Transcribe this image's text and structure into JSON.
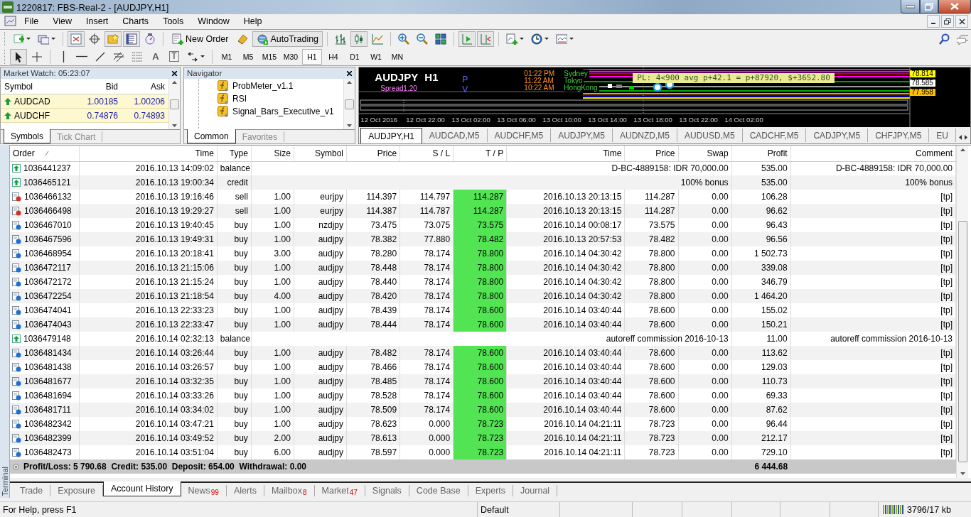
{
  "window": {
    "title": "1220817: FBS-Real-2 - [AUDJPY,H1]"
  },
  "menu": [
    "File",
    "View",
    "Insert",
    "Charts",
    "Tools",
    "Window",
    "Help"
  ],
  "toolbar": {
    "new_order": "New Order",
    "auto_trading": "AutoTrading"
  },
  "drawing_toolbar": {
    "text_tool": "A",
    "text_label_tool": "T"
  },
  "timeframes": [
    {
      "label": "M1",
      "selected": false
    },
    {
      "label": "M5",
      "selected": false
    },
    {
      "label": "M15",
      "selected": false
    },
    {
      "label": "M30",
      "selected": false
    },
    {
      "label": "H1",
      "selected": true
    },
    {
      "label": "H4",
      "selected": false
    },
    {
      "label": "D1",
      "selected": false
    },
    {
      "label": "W1",
      "selected": false
    },
    {
      "label": "MN",
      "selected": false
    }
  ],
  "market_watch": {
    "title": "Market Watch: 05:23:07",
    "columns": [
      "Symbol",
      "Bid",
      "Ask"
    ],
    "rows": [
      {
        "symbol": "AUDCAD",
        "bid": "1.00185",
        "ask": "1.00206"
      },
      {
        "symbol": "AUDCHF",
        "bid": "0.74876",
        "ask": "0.74893"
      }
    ],
    "tabs": [
      {
        "label": "Symbols",
        "selected": true
      },
      {
        "label": "Tick Chart",
        "selected": false
      }
    ]
  },
  "navigator": {
    "title": "Navigator",
    "items": [
      "ProbMeter_v1.1",
      "RSI",
      "Signal_Bars_Executive_v1"
    ],
    "tabs": [
      {
        "label": "Common",
        "selected": true
      },
      {
        "label": "Favorites",
        "selected": false
      }
    ]
  },
  "chart": {
    "symbol": "AUDJPY",
    "timeframe": "H1",
    "spread_label": "Spread",
    "spread": "1.20",
    "markers": [
      "P",
      "V"
    ],
    "sessions": [
      {
        "time": "01:22 PM",
        "city": "Sydney"
      },
      {
        "time": "11:22 AM",
        "city": "Tokyo"
      },
      {
        "time": "10:22 AM",
        "city": "HongKong"
      }
    ],
    "pl_text": "PL: 4<900 avg p+42.1 = p+87920, $+3652.80",
    "prices": [
      {
        "value": "78.814",
        "color": "#ffff00"
      },
      {
        "value": "78.585",
        "color": "#ffffff"
      },
      {
        "value": "77.958",
        "color": "#ffc000"
      }
    ],
    "time_labels": [
      "12 Oct 2016",
      "12 Oct 22:00",
      "13 Oct 02:00",
      "13 Oct 06:00",
      "13 Oct 10:00",
      "13 Oct 14:00",
      "13 Oct 18:00",
      "13 Oct 22:00",
      "14 Oct 02:00"
    ]
  },
  "chart_tabs": [
    {
      "label": "AUDJPY,H1",
      "selected": true
    },
    {
      "label": "AUDCAD,M5",
      "selected": false
    },
    {
      "label": "AUDCHF,M5",
      "selected": false
    },
    {
      "label": "AUDJPY,M5",
      "selected": false
    },
    {
      "label": "AUDNZD,M5",
      "selected": false
    },
    {
      "label": "AUDUSD,M5",
      "selected": false
    },
    {
      "label": "CADCHF,M5",
      "selected": false
    },
    {
      "label": "CADJPY,M5",
      "selected": false
    },
    {
      "label": "CHFJPY,M5",
      "selected": false
    },
    {
      "label": "EU",
      "selected": false
    }
  ],
  "history": {
    "columns": [
      "Order",
      "Time",
      "Type",
      "Size",
      "Symbol",
      "Price",
      "S / L",
      "T / P",
      "Time",
      "Price",
      "Swap",
      "Profit",
      "Comment"
    ],
    "rows": [
      {
        "kind": "balance",
        "order": "1036441237",
        "open_time": "2016.10.13 14:09:02",
        "type": "balance",
        "description": "D-BC-4889158: IDR 70,000.00",
        "profit": "535.00",
        "comment": "D-BC-4889158: IDR 70,000.00"
      },
      {
        "kind": "balance",
        "order": "1036465121",
        "open_time": "2016.10.13 19:00:34",
        "type": "credit",
        "description": "100% bonus",
        "profit": "535.00",
        "comment": "100% bonus"
      },
      {
        "kind": "sell",
        "order": "1036466132",
        "open_time": "2016.10.13 19:16:46",
        "type": "sell",
        "size": "1.00",
        "symbol": "eurjpy",
        "price": "114.397",
        "sl": "114.797",
        "tp": "114.287",
        "close_time": "2016.10.13 20:13:15",
        "close_price": "114.287",
        "swap": "0.00",
        "profit": "106.28",
        "comment": "[tp]"
      },
      {
        "kind": "sell",
        "order": "1036466498",
        "open_time": "2016.10.13 19:29:27",
        "type": "sell",
        "size": "1.00",
        "symbol": "eurjpy",
        "price": "114.387",
        "sl": "114.787",
        "tp": "114.287",
        "close_time": "2016.10.13 20:13:15",
        "close_price": "114.287",
        "swap": "0.00",
        "profit": "96.62",
        "comment": "[tp]"
      },
      {
        "kind": "buy",
        "order": "1036467010",
        "open_time": "2016.10.13 19:40:45",
        "type": "buy",
        "size": "1.00",
        "symbol": "nzdjpy",
        "price": "73.475",
        "sl": "73.075",
        "tp": "73.575",
        "close_time": "2016.10.14 00:08:17",
        "close_price": "73.575",
        "swap": "0.00",
        "profit": "96.43",
        "comment": "[tp]"
      },
      {
        "kind": "buy",
        "order": "1036467596",
        "open_time": "2016.10.13 19:49:31",
        "type": "buy",
        "size": "1.00",
        "symbol": "audjpy",
        "price": "78.382",
        "sl": "77.880",
        "tp": "78.482",
        "close_time": "2016.10.13 20:57:53",
        "close_price": "78.482",
        "swap": "0.00",
        "profit": "96.56",
        "comment": "[tp]"
      },
      {
        "kind": "buy",
        "order": "1036468954",
        "open_time": "2016.10.13 20:18:41",
        "type": "buy",
        "size": "3.00",
        "symbol": "audjpy",
        "price": "78.280",
        "sl": "78.174",
        "tp": "78.800",
        "close_time": "2016.10.14 04:30:42",
        "close_price": "78.800",
        "swap": "0.00",
        "profit": "1 502.73",
        "comment": "[tp]"
      },
      {
        "kind": "buy",
        "order": "1036472117",
        "open_time": "2016.10.13 21:15:06",
        "type": "buy",
        "size": "1.00",
        "symbol": "audjpy",
        "price": "78.448",
        "sl": "78.174",
        "tp": "78.800",
        "close_time": "2016.10.14 04:30:42",
        "close_price": "78.800",
        "swap": "0.00",
        "profit": "339.08",
        "comment": "[tp]"
      },
      {
        "kind": "buy",
        "order": "1036472172",
        "open_time": "2016.10.13 21:15:24",
        "type": "buy",
        "size": "1.00",
        "symbol": "audjpy",
        "price": "78.440",
        "sl": "78.174",
        "tp": "78.800",
        "close_time": "2016.10.14 04:30:42",
        "close_price": "78.800",
        "swap": "0.00",
        "profit": "346.79",
        "comment": "[tp]"
      },
      {
        "kind": "buy",
        "order": "1036472254",
        "open_time": "2016.10.13 21:18:54",
        "type": "buy",
        "size": "4.00",
        "symbol": "audjpy",
        "price": "78.420",
        "sl": "78.174",
        "tp": "78.800",
        "close_time": "2016.10.14 04:30:42",
        "close_price": "78.800",
        "swap": "0.00",
        "profit": "1 464.20",
        "comment": "[tp]"
      },
      {
        "kind": "buy",
        "order": "1036474041",
        "open_time": "2016.10.13 22:33:23",
        "type": "buy",
        "size": "1.00",
        "symbol": "audjpy",
        "price": "78.439",
        "sl": "78.174",
        "tp": "78.600",
        "close_time": "2016.10.14 03:40:44",
        "close_price": "78.600",
        "swap": "0.00",
        "profit": "155.02",
        "comment": "[tp]"
      },
      {
        "kind": "buy",
        "order": "1036474043",
        "open_time": "2016.10.13 22:33:47",
        "type": "buy",
        "size": "1.00",
        "symbol": "audjpy",
        "price": "78.444",
        "sl": "78.174",
        "tp": "78.600",
        "close_time": "2016.10.14 03:40:44",
        "close_price": "78.600",
        "swap": "0.00",
        "profit": "150.21",
        "comment": "[tp]"
      },
      {
        "kind": "balance",
        "order": "1036479148",
        "open_time": "2016.10.14 02:32:13",
        "type": "balance",
        "description": "autoreff commission 2016-10-13",
        "profit": "11.00",
        "comment": "autoreff commission 2016-10-13"
      },
      {
        "kind": "buy",
        "order": "1036481434",
        "open_time": "2016.10.14 03:26:44",
        "type": "buy",
        "size": "1.00",
        "symbol": "audjpy",
        "price": "78.482",
        "sl": "78.174",
        "tp": "78.600",
        "close_time": "2016.10.14 03:40:44",
        "close_price": "78.600",
        "swap": "0.00",
        "profit": "113.62",
        "comment": "[tp]"
      },
      {
        "kind": "buy",
        "order": "1036481438",
        "open_time": "2016.10.14 03:26:57",
        "type": "buy",
        "size": "1.00",
        "symbol": "audjpy",
        "price": "78.466",
        "sl": "78.174",
        "tp": "78.600",
        "close_time": "2016.10.14 03:40:44",
        "close_price": "78.600",
        "swap": "0.00",
        "profit": "129.03",
        "comment": "[tp]"
      },
      {
        "kind": "buy",
        "order": "1036481677",
        "open_time": "2016.10.14 03:32:35",
        "type": "buy",
        "size": "1.00",
        "symbol": "audjpy",
        "price": "78.485",
        "sl": "78.174",
        "tp": "78.600",
        "close_time": "2016.10.14 03:40:44",
        "close_price": "78.600",
        "swap": "0.00",
        "profit": "110.73",
        "comment": "[tp]"
      },
      {
        "kind": "buy",
        "order": "1036481694",
        "open_time": "2016.10.14 03:33:26",
        "type": "buy",
        "size": "1.00",
        "symbol": "audjpy",
        "price": "78.528",
        "sl": "78.174",
        "tp": "78.600",
        "close_time": "2016.10.14 03:40:44",
        "close_price": "78.600",
        "swap": "0.00",
        "profit": "69.33",
        "comment": "[tp]"
      },
      {
        "kind": "buy",
        "order": "1036481711",
        "open_time": "2016.10.14 03:34:02",
        "type": "buy",
        "size": "1.00",
        "symbol": "audjpy",
        "price": "78.509",
        "sl": "78.174",
        "tp": "78.600",
        "close_time": "2016.10.14 03:40:44",
        "close_price": "78.600",
        "swap": "0.00",
        "profit": "87.62",
        "comment": "[tp]"
      },
      {
        "kind": "buy",
        "order": "1036482342",
        "open_time": "2016.10.14 03:47:21",
        "type": "buy",
        "size": "1.00",
        "symbol": "audjpy",
        "price": "78.623",
        "sl": "0.000",
        "tp": "78.723",
        "close_time": "2016.10.14 04:21:11",
        "close_price": "78.723",
        "swap": "0.00",
        "profit": "96.44",
        "comment": "[tp]"
      },
      {
        "kind": "buy",
        "order": "1036482399",
        "open_time": "2016.10.14 03:49:52",
        "type": "buy",
        "size": "2.00",
        "symbol": "audjpy",
        "price": "78.613",
        "sl": "0.000",
        "tp": "78.723",
        "close_time": "2016.10.14 04:21:11",
        "close_price": "78.723",
        "swap": "0.00",
        "profit": "212.17",
        "comment": "[tp]"
      },
      {
        "kind": "buy",
        "order": "1036482473",
        "open_time": "2016.10.14 03:51:04",
        "type": "buy",
        "size": "6.00",
        "symbol": "audjpy",
        "price": "78.597",
        "sl": "0.000",
        "tp": "78.723",
        "close_time": "2016.10.14 04:21:11",
        "close_price": "78.723",
        "swap": "0.00",
        "profit": "729.10",
        "comment": "[tp]"
      }
    ],
    "summary": "Profit/Loss: 5 790.68  Credit: 535.00  Deposit: 654.00  Withdrawal: 0.00",
    "total": "6 444.68"
  },
  "terminal_label": "Terminal",
  "terminal_tabs": [
    {
      "label": "Trade",
      "selected": false
    },
    {
      "label": "Exposure",
      "selected": false
    },
    {
      "label": "Account History",
      "selected": true
    },
    {
      "label": "News",
      "badge": "99",
      "selected": false
    },
    {
      "label": "Alerts",
      "selected": false
    },
    {
      "label": "Mailbox",
      "badge": "8",
      "selected": false
    },
    {
      "label": "Market",
      "badge": "47",
      "selected": false
    },
    {
      "label": "Signals",
      "selected": false
    },
    {
      "label": "Code Base",
      "selected": false
    },
    {
      "label": "Experts",
      "selected": false
    },
    {
      "label": "Journal",
      "selected": false
    }
  ],
  "status_bar": {
    "help": "For Help, press F1",
    "profile": "Default",
    "traffic": "3796/17 kb"
  }
}
